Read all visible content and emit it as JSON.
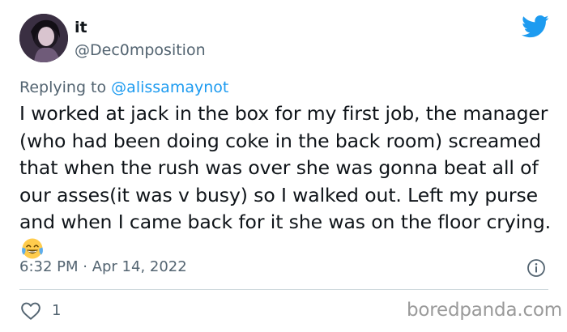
{
  "author": {
    "display_name": "it",
    "handle": "@Dec0mposition"
  },
  "replying": {
    "prefix": "Replying to",
    "mention": "@alissamaynot"
  },
  "tweet": {
    "text": "I worked at jack in the box for my first job, the manager (who had been doing coke in the back room) screamed that when the rush was over she was gonna beat all of our asses(it was v busy) so I walked out. Left my purse and when I came back for it she was on the floor crying.",
    "emoji": "face-with-tears-of-joy",
    "timestamp": "6:32 PM · Apr 14, 2022",
    "like_count": "1"
  },
  "watermark": "boredpanda.com",
  "colors": {
    "twitter_blue": "#1d9bf0",
    "secondary_text": "#536471",
    "primary_text": "#0f1419",
    "divider": "#cfd9de"
  }
}
